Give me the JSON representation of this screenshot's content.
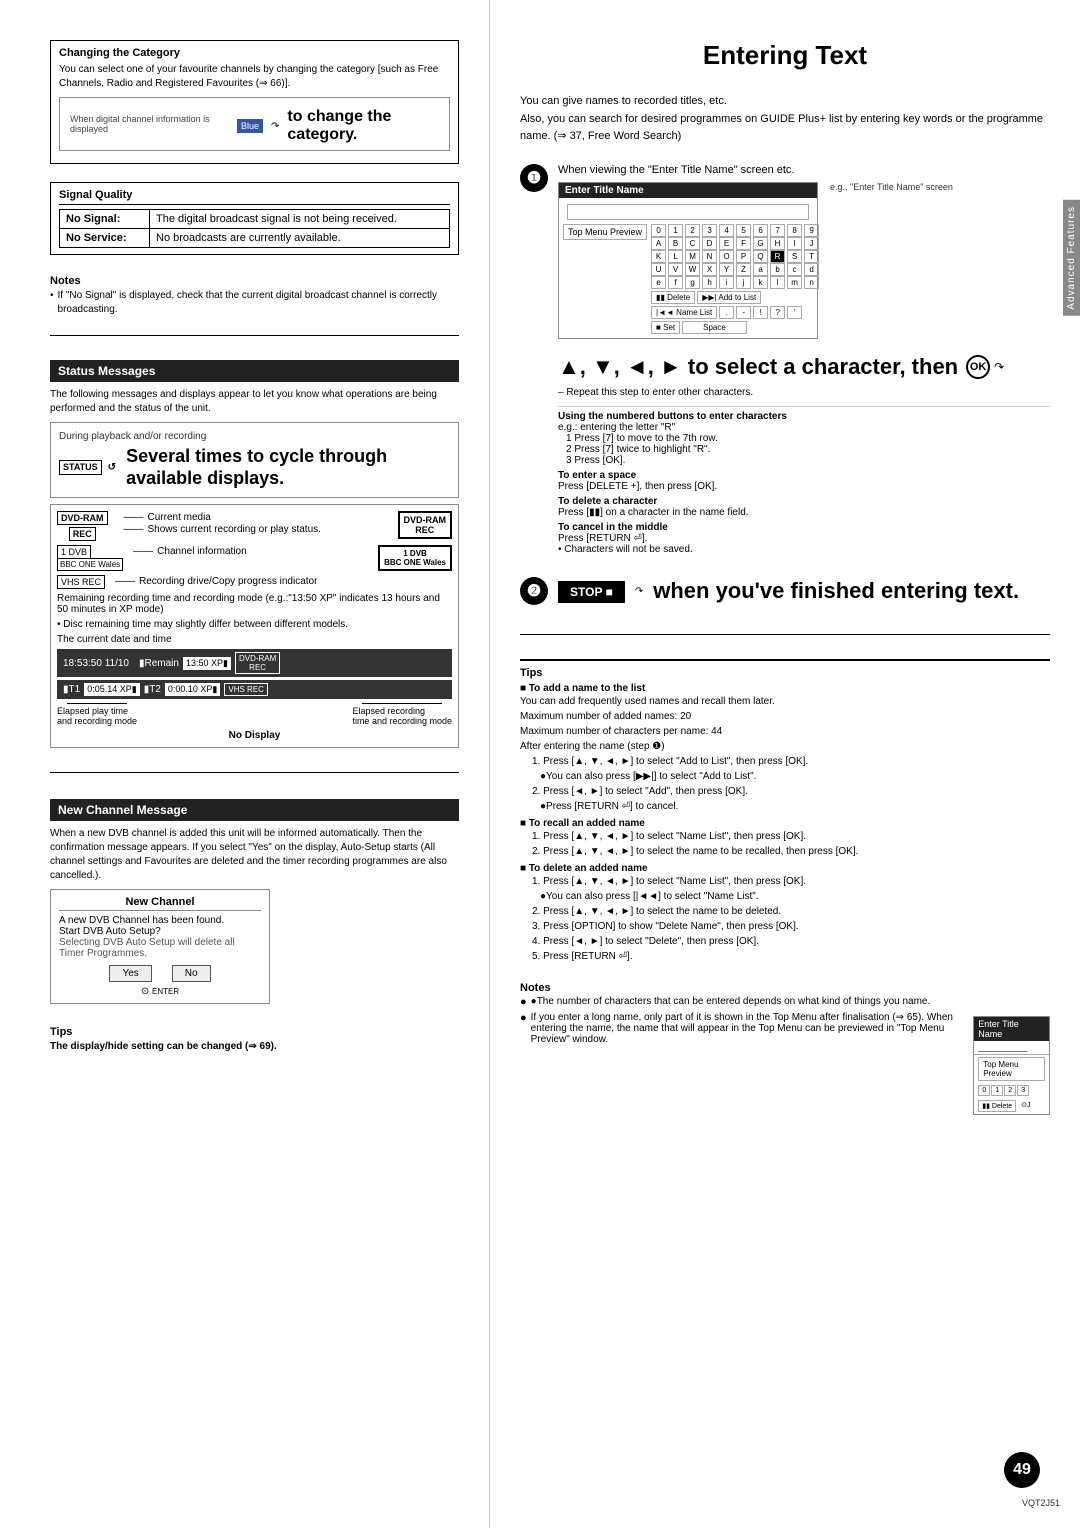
{
  "page": {
    "title": "Entering Text",
    "page_number": "49",
    "vqt_code": "VQT2J51"
  },
  "left": {
    "changing_category": {
      "title": "Changing the Category",
      "body": "You can select one of your favourite channels by changing the category [such as Free Channels, Radio and Registered Favourites (⇒ 66)].",
      "inner_box_label": "When digital channel information is displayed",
      "inner_box_text": "to change the category.",
      "blue_btn": "Blue"
    },
    "signal_quality": {
      "title": "Signal Quality",
      "rows": [
        {
          "label": "No Signal:",
          "value": "The digital broadcast signal is not being received."
        },
        {
          "label": "No Service:",
          "value": "No broadcasts are currently available."
        }
      ]
    },
    "notes": {
      "title": "Notes",
      "items": [
        "If \"No Signal\" is displayed, check that the current digital broadcast channel is correctly broadcasting."
      ]
    },
    "status_messages": {
      "section_title": "Status Messages",
      "intro": "The following messages and displays appear to let you know what operations are being performed and the status of the unit.",
      "display_box": {
        "label": "During playback and/or recording",
        "status_badge": "STATUS",
        "main_text": "Several times to cycle through available displays.",
        "icon": "↺"
      },
      "diagram": {
        "dvd_ram": "DVD-RAM",
        "rec": "REC",
        "line1": "Current media",
        "line2": "Shows current recording or play status.",
        "dvd_1": "1 DVB",
        "bbc_one": "BBC ONE Wales",
        "line3": "Channel information",
        "vhs_rec": "VHS REC",
        "line4": "Recording drive/Copy progress indicator",
        "remaining_note": "Remaining recording time and recording mode (e.g.:\"13:50 XP\" indicates 13 hours and 50 minutes in XP mode)",
        "disc_note": "• Disc remaining time may slightly differ between different models.",
        "date_note": "The current date and time",
        "time_display": "18:53:50 11/10",
        "remain": "▮Remain",
        "time_val": "13:50 XP▮",
        "t1": "▮T1",
        "t1_time": "0:05.14 XP▮",
        "t2": "▮T2",
        "t2_time": "0:00.10 XP▮",
        "elapsed_note": "Elapsed play time and recording mode",
        "elapsed_rec_note": "Elapsed recording time and recording mode",
        "no_display": "No Display"
      }
    },
    "new_channel": {
      "section_title": "New Channel Message",
      "body": "When a new DVB channel is added this unit will be informed automatically. Then the confirmation message appears. If you select \"Yes\" on the display, Auto-Setup starts (All channel settings and Favourites are deleted and the timer recording programmes are also cancelled.).",
      "box_title": "New Channel",
      "box_text1": "A new DVB Channel has been found.",
      "box_text2": "Start DVB Auto Setup?",
      "box_text3": "Selecting DVB Auto Setup will delete all Timer Programmes.",
      "yes_label": "Yes",
      "no_label": "No"
    },
    "tips": {
      "title": "Tips",
      "text": "The display/hide setting can be changed (⇒ 69)."
    }
  },
  "right": {
    "intro_lines": [
      "You can give names to recorded titles, etc.",
      "Also, you can search for desired programmes on GUIDE Plus+ list by entering key words or the programme name. (⇒ 37, Free Word Search)"
    ],
    "step1": {
      "number": "1",
      "label": "When viewing the \"Enter Title Name\" screen etc.",
      "example": "e.g., \"Enter Title Name\" screen",
      "title_box_header": "Enter Title Name",
      "preview_label": "Top Menu Preview",
      "nav_text": "▲, ▼, ◄, ► to select a character, then",
      "ok_label": "OK",
      "repeat_note": "– Repeat this step to enter other characters.",
      "using_numbered": "Using the numbered buttons to enter characters",
      "eg_r": "e.g.: entering the letter \"R\"",
      "step1a": "1   Press [7] to move to the 7th row.",
      "step2a": "2   Press [7] twice to highlight \"R\".",
      "step3a": "3   Press [OK].",
      "to_enter_space": "To enter a space",
      "space_text": "Press [DELETE +], then press [OK].",
      "to_delete_char": "To delete a character",
      "delete_text": "Press [▮▮] on a character in the name field.",
      "to_cancel": "To cancel in the middle",
      "cancel_text": "Press [RETURN ⏎].",
      "cancel_note": "• Characters will not be saved."
    },
    "step2": {
      "number": "2",
      "stop_label": "STOP",
      "stop_icon": "■",
      "finish_text": "when you've finished entering text."
    },
    "tips": {
      "title": "Tips",
      "add_name_title": "■ To add a name to the list",
      "add_name_intro": "You can add frequently used names and recall them later.",
      "max_names": "Maximum number of added names: 20",
      "max_chars": "Maximum number of characters per name: 44",
      "after_entering": "After entering the name (step ❶)",
      "add_steps": [
        "1.  Press [▲, ▼, ◄, ►] to select \"Add to List\", then press [OK].",
        "●You can also press [▶▶|] to select \"Add to List\".",
        "2.  Press [◄, ►] to select \"Add\", then press [OK].",
        "●Press [RETURN ⏎] to cancel."
      ],
      "recall_title": "■ To recall an added name",
      "recall_steps": [
        "1.  Press [▲, ▼, ◄, ►] to select \"Name List\", then press [OK].",
        "2.  Press [▲, ▼, ◄, ►] to select the name to be recalled, then press [OK]."
      ],
      "delete_title": "■ To delete an added name",
      "delete_steps": [
        "1.  Press [▲, ▼, ◄, ►] to select \"Name List\", then press [OK].",
        "●You can also press [|◄◄] to select \"Name List\".",
        "2.  Press [▲, ▼, ◄, ►] to select the name to be deleted.",
        "3.  Press [OPTION] to show \"Delete Name\", then press [OK].",
        "4.  Press [◄, ►] to select \"Delete\", then press [OK].",
        "5.  Press [RETURN ⏎]."
      ]
    },
    "notes": {
      "title": "Notes",
      "items": [
        "●The number of characters that can be entered depends on what kind of things you name.",
        "●If you enter a long name, only part of it is shown in the Top Menu after finalisation (⇒ 65). When entering the name, the name that will appear in the Top Menu can be previewed in \"Top Menu Preview\" window."
      ]
    },
    "advanced_features": "Advanced Features"
  }
}
